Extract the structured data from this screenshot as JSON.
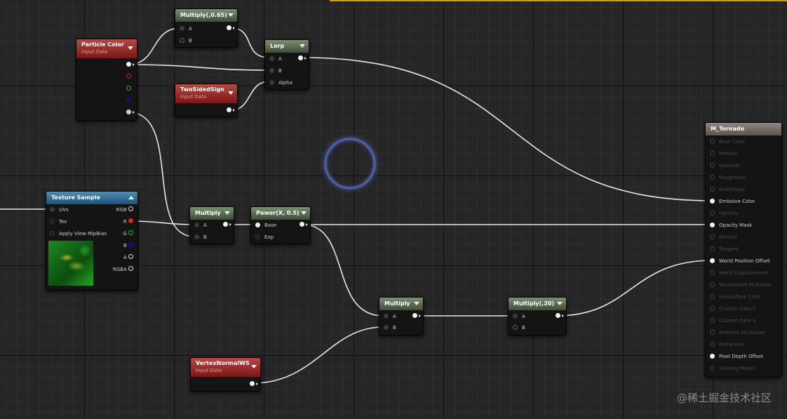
{
  "graph": {
    "watermark": "@稀土掘金技术社区",
    "nodes": {
      "multiply_065": {
        "title": "Multiply(,0.65)",
        "pins": [
          "A",
          "B"
        ]
      },
      "particle_color": {
        "title": "Particle Color",
        "subtitle": "Input Data"
      },
      "lerp": {
        "title": "Lerp",
        "pins": [
          "A",
          "B",
          "Alpha"
        ]
      },
      "two_sided_sign": {
        "title": "TwoSidedSign",
        "subtitle": "Input Data"
      },
      "texture_sample": {
        "title": "Texture Sample",
        "inputs": [
          "UVs",
          "Tex",
          "Apply View MipBias"
        ],
        "outputs": [
          "RGB",
          "R",
          "G",
          "B",
          "A",
          "RGBA"
        ]
      },
      "multiply_1": {
        "title": "Multiply",
        "pins": [
          "A",
          "B"
        ]
      },
      "power": {
        "title": "Power(X, 0.5)",
        "pins": [
          "Base",
          "Exp"
        ]
      },
      "multiply_2": {
        "title": "Multiply",
        "pins": [
          "A",
          "B"
        ]
      },
      "multiply_20": {
        "title": "Multiply(,20)",
        "pins": [
          "A",
          "B"
        ]
      },
      "vertex_normal": {
        "title": "VertexNormalWS",
        "subtitle": "Input Data"
      },
      "m_tornado": {
        "title": "M_Tornado",
        "pins": [
          {
            "label": "Base Color",
            "active": false
          },
          {
            "label": "Metallic",
            "active": false
          },
          {
            "label": "Specular",
            "active": false
          },
          {
            "label": "Roughness",
            "active": false
          },
          {
            "label": "Anisotropy",
            "active": false
          },
          {
            "label": "Emissive Color",
            "active": true
          },
          {
            "label": "Opacity",
            "active": false
          },
          {
            "label": "Opacity Mask",
            "active": true
          },
          {
            "label": "Normal",
            "active": false
          },
          {
            "label": "Tangent",
            "active": false
          },
          {
            "label": "World Position Offset",
            "active": true
          },
          {
            "label": "World Displacement",
            "active": false
          },
          {
            "label": "Tessellation Multiplier",
            "active": false
          },
          {
            "label": "Subsurface Color",
            "active": false
          },
          {
            "label": "Custom Data 0",
            "active": false
          },
          {
            "label": "Custom Data 1",
            "active": false
          },
          {
            "label": "Ambient Occlusion",
            "active": false
          },
          {
            "label": "Refraction",
            "active": false
          },
          {
            "label": "Pixel Depth Offset",
            "active": true
          },
          {
            "label": "Shading Model",
            "active": false
          }
        ]
      }
    }
  }
}
